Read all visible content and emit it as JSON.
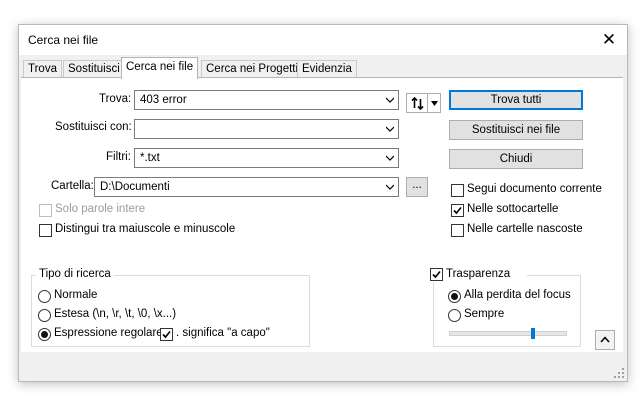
{
  "window": {
    "title": "Cerca nei file"
  },
  "tabs": [
    {
      "label": "Trova"
    },
    {
      "label": "Sostituisci"
    },
    {
      "label": "Cerca nei file"
    },
    {
      "label": "Cerca nei Progetti"
    },
    {
      "label": "Evidenzia"
    }
  ],
  "active_tab": "Cerca nei file",
  "form": {
    "find_label": "Trova:",
    "find_value": "403 error",
    "replace_label": "Sostituisci con:",
    "replace_value": "",
    "filters_label": "Filtri:",
    "filters_value": "*.txt",
    "folder_label": "Cartella:",
    "folder_value": "D:\\Documenti",
    "browse_label": "...",
    "swap_icon": "swap-arrows-icon"
  },
  "buttons": {
    "find_all": "Trova tutti",
    "replace_in_files": "Sostituisci nei file",
    "close": "Chiudi",
    "collapse": "^"
  },
  "options": {
    "whole_word": {
      "label": "Solo parole intere",
      "checked": false,
      "enabled": false
    },
    "match_case": {
      "label": "Distingui tra maiuscole e minuscole",
      "checked": false
    },
    "follow_doc": {
      "label": "Segui documento corrente",
      "checked": false
    },
    "subfolders": {
      "label": "Nelle sottocartelle",
      "checked": true
    },
    "hidden_folders": {
      "label": "Nelle cartelle nascoste",
      "checked": false
    }
  },
  "search_mode": {
    "title": "Tipo di ricerca",
    "normal": "Normale",
    "extended": "Estesa (\\n, \\r, \\t, \\0, \\x...)",
    "regex": "Espressione regolare",
    "selected": "regex",
    "dot_newline_label": ". significa \"a capo\"",
    "dot_newline_checked": true
  },
  "transparency": {
    "title": "Trasparenza",
    "enabled": true,
    "on_focus_loss": "Alla perdita del focus",
    "always": "Sempre",
    "selected": "on_focus_loss",
    "level": 0.72
  },
  "colors": {
    "accent": "#0078d7",
    "window_bg": "#f0f0f0"
  }
}
